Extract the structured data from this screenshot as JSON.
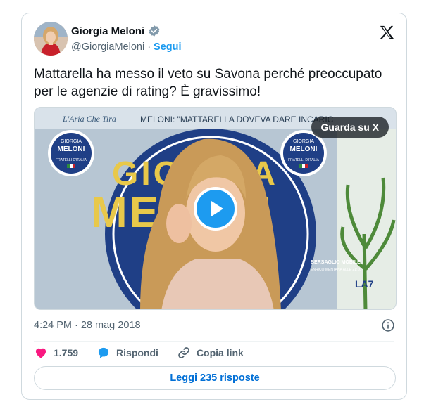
{
  "author": {
    "name": "Giorgia Meloni",
    "handle": "@GiorgiaMeloni",
    "separator": "·",
    "follow_label": "Segui"
  },
  "tweet": {
    "text": "Mattarella ha messo il veto su Savona perché preoccupato per le agenzie di rating? È gravissimo!",
    "timestamp": "4:24 PM · 28 mag 2018"
  },
  "media": {
    "watch_label": "Guarda su X",
    "overlay_caption": "MELONI: \"MATTARELLA DOVEVA DARE INCARIC",
    "show_script": "L'Aria Che Tira",
    "backdrop_text_line1": "GIORGIA",
    "backdrop_text_line2": "MELONI",
    "logo_top": "GIORGIA",
    "logo_middle": "MELONI",
    "logo_bottom": "FRATELLI D'ITALIA",
    "corner_caption": "BERSAGLIO MOBILE",
    "corner_subcaption": "ENRICO MENTANA ALLE 21:10",
    "channel_logo": "LA7"
  },
  "actions": {
    "likes": "1.759",
    "reply_label": "Rispondi",
    "copy_link_label": "Copia link"
  },
  "replies_button": "Leggi 235 risposte",
  "colors": {
    "accent": "#1d9bf0",
    "like": "#f91880",
    "link": "#006fd6",
    "muted": "#536471"
  }
}
